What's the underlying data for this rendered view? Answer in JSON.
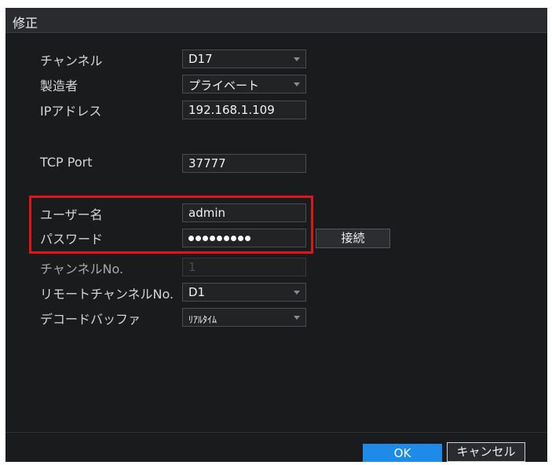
{
  "dialog": {
    "title": "修正",
    "fields": {
      "channel": {
        "label": "チャンネル",
        "value": "D17"
      },
      "manufacturer": {
        "label": "製造者",
        "value": "プライベート"
      },
      "ip_address": {
        "label": "IPアドレス",
        "value": "192.168.1.109"
      },
      "tcp_port": {
        "label": "TCP Port",
        "value": "37777"
      },
      "username": {
        "label": "ユーザー名",
        "value": "admin"
      },
      "password": {
        "label": "パスワード",
        "value": "●●●●●●●●●",
        "dot_count": 9
      },
      "channel_no": {
        "label": "チャンネルNo.",
        "value": "1"
      },
      "remote_channel_no": {
        "label": "リモートチャンネルNo.",
        "value": "D1"
      },
      "decode_buffer": {
        "label": "デコードバッファ",
        "value": "ﾘｱﾙﾀｲﾑ"
      }
    },
    "buttons": {
      "connect": "接続",
      "ok": "OK",
      "cancel": "キャンセル"
    }
  },
  "colors": {
    "background": "#1a1b1d",
    "highlight": "#e0141b",
    "ok_button": "#1e8be8"
  }
}
